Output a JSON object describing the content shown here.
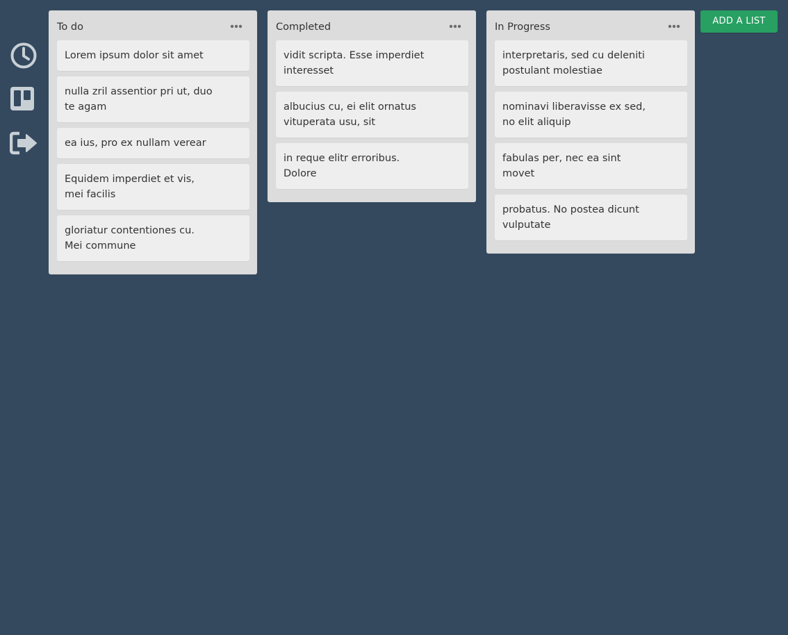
{
  "sidebar": {
    "items": [
      {
        "icon": "clock-icon"
      },
      {
        "icon": "board-icon"
      },
      {
        "icon": "sign-out-icon"
      }
    ]
  },
  "colors": {
    "background": "#34495e",
    "list_background": "#dcdcdc",
    "card_background": "#eeeeee",
    "accent": "#27a062",
    "icon": "#c8d0d6"
  },
  "board": {
    "lists": [
      {
        "title": "To do",
        "menu_icon": "ellipsis-icon",
        "cards": [
          "Lorem ipsum dolor sit amet",
          "nulla zril assentior pri ut, duo\nte agam",
          "ea ius, pro ex nullam verear",
          "Equidem imperdiet et vis,\nmei facilis",
          "gloriatur contentiones cu.\nMei commune"
        ]
      },
      {
        "title": "Completed",
        "menu_icon": "ellipsis-icon",
        "cards": [
          "vidit scripta. Esse imperdiet\ninteresset",
          "albucius cu, ei elit ornatus\nvituperata usu, sit",
          "in reque elitr erroribus.\nDolore"
        ]
      },
      {
        "title": "In Progress",
        "menu_icon": "ellipsis-icon",
        "cards": [
          "interpretaris, sed cu deleniti\npostulant molestiae",
          "nominavi liberavisse ex sed,\nno elit aliquip",
          "fabulas per, nec ea sint\nmovet",
          "probatus. No postea dicunt\nvulputate"
        ]
      }
    ]
  },
  "add_list": {
    "label": "ADD A LIST"
  }
}
